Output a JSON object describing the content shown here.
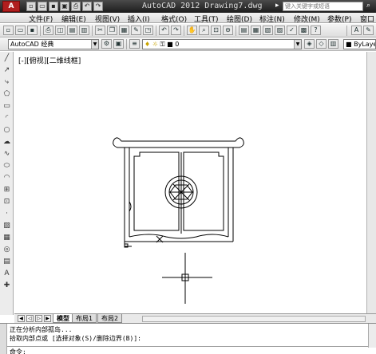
{
  "app": {
    "logo": "A",
    "title": "AutoCAD 2012     Drawing7.dwg",
    "search_placeholder": "键入关键字或短语"
  },
  "menu": [
    "文件(F)",
    "编辑(E)",
    "视图(V)",
    "插入(I)",
    "格式(O)",
    "工具(T)",
    "绘图(D)",
    "标注(N)",
    "修改(M)",
    "参数(P)",
    "窗口"
  ],
  "toolbar": {
    "workspace": "AutoCAD 经典",
    "layer_value": "0",
    "color_value": "ByLayer"
  },
  "viewport_label": "[-][俯视][二维线框]",
  "tabs": [
    "模型",
    "布局1",
    "布局2"
  ],
  "command": {
    "history": [
      "正在分析内部孤岛...",
      "拾取内部点或 [选择对象(S)/删除边界(B)]:"
    ],
    "prompt": "命令:"
  }
}
